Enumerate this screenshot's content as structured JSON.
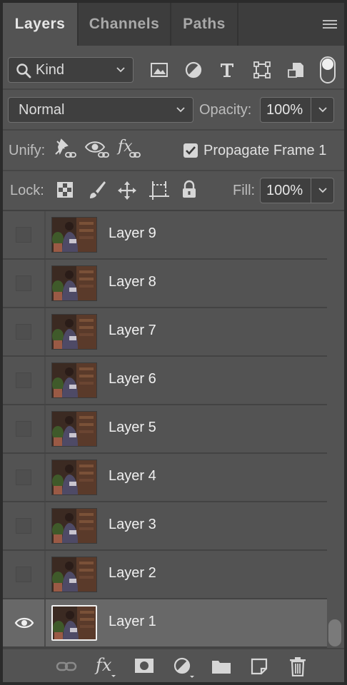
{
  "tabs": [
    {
      "label": "Layers",
      "active": true
    },
    {
      "label": "Channels",
      "active": false
    },
    {
      "label": "Paths",
      "active": false
    }
  ],
  "filter": {
    "kind_label": "Kind"
  },
  "blend": {
    "mode": "Normal",
    "opacity_label": "Opacity:",
    "opacity_value": "100%"
  },
  "unify": {
    "label": "Unify:",
    "propagate_label": "Propagate Frame 1",
    "propagate_checked": true
  },
  "lock": {
    "label": "Lock:",
    "fill_label": "Fill:",
    "fill_value": "100%"
  },
  "layers": [
    {
      "name": "Layer 9",
      "visible": false,
      "selected": false
    },
    {
      "name": "Layer 8",
      "visible": false,
      "selected": false
    },
    {
      "name": "Layer 7",
      "visible": false,
      "selected": false
    },
    {
      "name": "Layer 6",
      "visible": false,
      "selected": false
    },
    {
      "name": "Layer 5",
      "visible": false,
      "selected": false
    },
    {
      "name": "Layer 4",
      "visible": false,
      "selected": false
    },
    {
      "name": "Layer 3",
      "visible": false,
      "selected": false
    },
    {
      "name": "Layer 2",
      "visible": false,
      "selected": false
    },
    {
      "name": "Layer 1",
      "visible": true,
      "selected": true
    }
  ],
  "colors": {
    "panel": "#535353",
    "tabbar": "#3d3d3d",
    "selected_row": "#686868"
  }
}
